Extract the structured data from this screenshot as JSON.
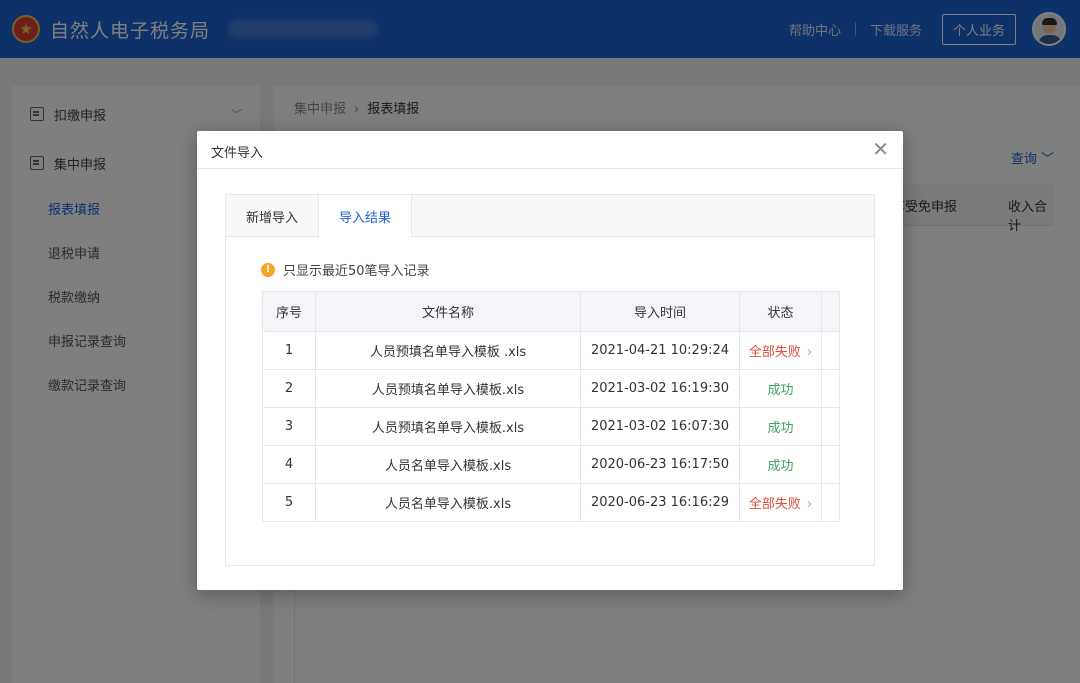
{
  "header": {
    "app_title": "自然人电子税务局",
    "help_link": "帮助中心",
    "download_link": "下载服务",
    "personal_button": "个人业务"
  },
  "sidebar": {
    "groups": [
      {
        "label": "扣缴申报",
        "chevron": "chevron-down-icon"
      },
      {
        "label": "集中申报"
      }
    ],
    "sub_items": [
      "报表填报",
      "退税申请",
      "税款缴纳",
      "申报记录查询",
      "缴款记录查询"
    ],
    "active_sub": "报表填报"
  },
  "main": {
    "breadcrumb": [
      "集中申报",
      "报表填报"
    ],
    "query_label": "查询",
    "bg_columns": [
      "享受免申报",
      "收入合计"
    ]
  },
  "modal": {
    "title": "文件导入",
    "close_icon": "close-icon",
    "tabs": [
      {
        "label": "新增导入",
        "active": false
      },
      {
        "label": "导入结果",
        "active": true
      }
    ],
    "notice": "只显示最近50笔导入记录",
    "table": {
      "columns": [
        "序号",
        "文件名称",
        "导入时间",
        "状态"
      ],
      "rows": [
        {
          "no": "1",
          "file": "人员预填名单导入模板 .xls",
          "time": "2021-04-21 10:29:24",
          "status": "全部失败",
          "status_type": "fail"
        },
        {
          "no": "2",
          "file": "人员预填名单导入模板.xls",
          "time": "2021-03-02 16:19:30",
          "status": "成功",
          "status_type": "ok"
        },
        {
          "no": "3",
          "file": "人员预填名单导入模板.xls",
          "time": "2021-03-02 16:07:30",
          "status": "成功",
          "status_type": "ok"
        },
        {
          "no": "4",
          "file": "人员名单导入模板.xls",
          "time": "2020-06-23 16:17:50",
          "status": "成功",
          "status_type": "ok"
        },
        {
          "no": "5",
          "file": "人员名单导入模板.xls",
          "time": "2020-06-23 16:16:29",
          "status": "全部失败",
          "status_type": "fail"
        }
      ]
    }
  },
  "colors": {
    "primary": "#1a63d3",
    "fail": "#e04b3c",
    "success": "#3aa55b",
    "warning": "#f5a623"
  }
}
